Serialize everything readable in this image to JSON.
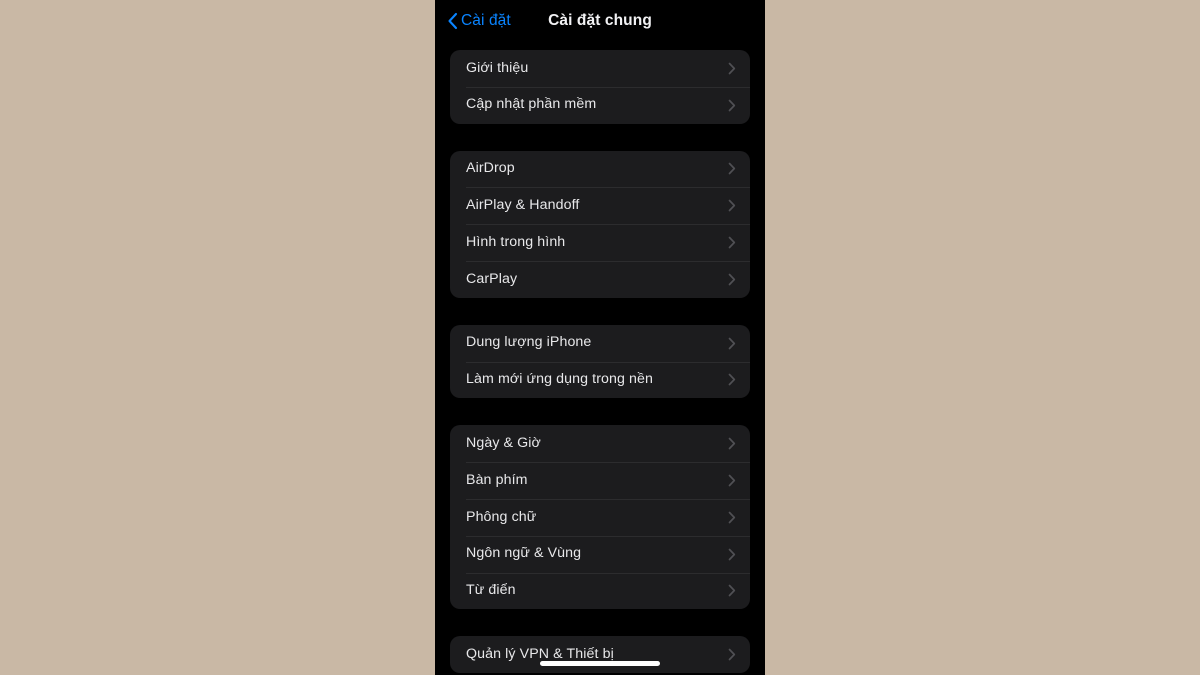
{
  "background_color": "#c9b8a5",
  "device": {
    "screen_background": "#000000",
    "home_indicator_color": "#ffffff"
  },
  "nav": {
    "back_label": "Cài đặt",
    "back_icon": "chevron-left-icon",
    "back_color": "#0a84ff",
    "title": "Cài đặt chung"
  },
  "colors": {
    "group_background": "#1c1c1e",
    "separator": "#2c2c2e",
    "row_label": "#e8e8ea",
    "chevron": "#5a5a5e",
    "accent": "#0a84ff"
  },
  "groups": [
    {
      "rows": [
        {
          "label": "Giới thiệu",
          "accessory": "chevron-right-icon"
        },
        {
          "label": "Cập nhật phần mềm",
          "accessory": "chevron-right-icon"
        }
      ]
    },
    {
      "rows": [
        {
          "label": "AirDrop",
          "accessory": "chevron-right-icon"
        },
        {
          "label": "AirPlay & Handoff",
          "accessory": "chevron-right-icon"
        },
        {
          "label": "Hình trong hình",
          "accessory": "chevron-right-icon"
        },
        {
          "label": "CarPlay",
          "accessory": "chevron-right-icon"
        }
      ]
    },
    {
      "rows": [
        {
          "label": "Dung lượng iPhone",
          "accessory": "chevron-right-icon"
        },
        {
          "label": "Làm mới ứng dụng trong nền",
          "accessory": "chevron-right-icon"
        }
      ]
    },
    {
      "rows": [
        {
          "label": "Ngày & Giờ",
          "accessory": "chevron-right-icon"
        },
        {
          "label": "Bàn phím",
          "accessory": "chevron-right-icon"
        },
        {
          "label": "Phông chữ",
          "accessory": "chevron-right-icon"
        },
        {
          "label": "Ngôn ngữ & Vùng",
          "accessory": "chevron-right-icon"
        },
        {
          "label": "Từ điển",
          "accessory": "chevron-right-icon"
        }
      ]
    },
    {
      "rows": [
        {
          "label": "Quản lý VPN & Thiết bị",
          "accessory": "chevron-right-icon"
        }
      ]
    }
  ]
}
